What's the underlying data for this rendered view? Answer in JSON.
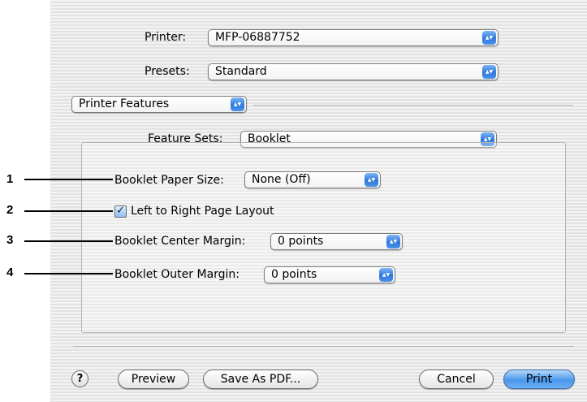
{
  "printer": {
    "label": "Printer:",
    "value": "MFP-06887752"
  },
  "presets": {
    "label": "Presets:",
    "value": "Standard"
  },
  "pane": {
    "value": "Printer Features"
  },
  "feature_sets": {
    "label": "Feature Sets:",
    "value": "Booklet"
  },
  "booklet": {
    "paper_size": {
      "label": "Booklet Paper Size:",
      "value": "None (Off)"
    },
    "layout_checkbox": {
      "label": "Left to Right Page Layout",
      "checked": true
    },
    "center_margin": {
      "label": "Booklet Center Margin:",
      "value": "0 points"
    },
    "outer_margin": {
      "label": "Booklet Outer Margin:",
      "value": "0 points"
    }
  },
  "callouts": [
    "1",
    "2",
    "3",
    "4"
  ],
  "buttons": {
    "help": "?",
    "preview": "Preview",
    "save_pdf": "Save As PDF...",
    "cancel": "Cancel",
    "print": "Print"
  },
  "colors": {
    "accent": "#3b86e8",
    "background": "#ececec"
  }
}
